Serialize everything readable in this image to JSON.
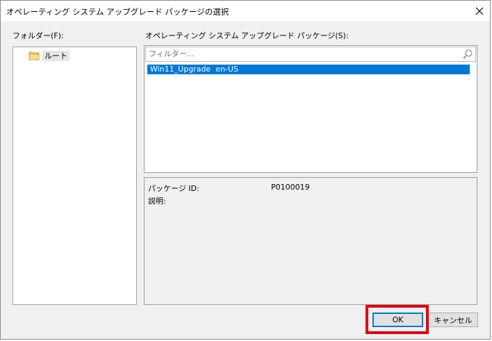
{
  "window": {
    "title": "オペレーティング システム アップグレード パッケージの選択"
  },
  "folder_pane": {
    "label": "フォルダー(F):",
    "items": [
      {
        "label": "ルート",
        "icon": "folder-icon"
      }
    ]
  },
  "package_pane": {
    "label": "オペレーティング システム アップグレード パッケージ(S):",
    "filter_placeholder": "フィルター...",
    "filter_value": "",
    "rows": [
      {
        "name": "Win11_Upgrade  en-US",
        "selected": true
      }
    ]
  },
  "details": {
    "package_id_label": "パッケージ ID:",
    "package_id_value": "P0100019",
    "description_label": "説明:"
  },
  "buttons": {
    "ok": "OK",
    "cancel": "キャンセル"
  },
  "colors": {
    "selection": "#0078d7",
    "highlight": "#e3000f",
    "dialog_bg": "#f0f0f0"
  }
}
